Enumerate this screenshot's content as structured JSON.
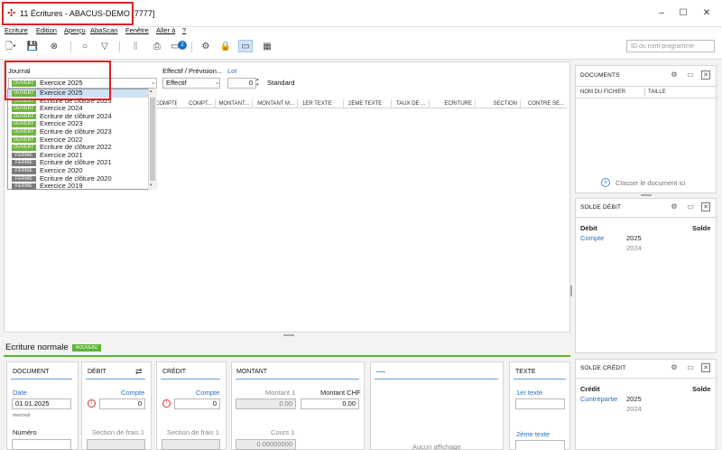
{
  "window": {
    "title": "11 Écritures - ABACUS-DEMO [7777]",
    "buttons": [
      "–",
      "☐",
      "✕"
    ]
  },
  "menu": [
    "Ecriture",
    "Edition",
    "Aperçu",
    "AbaScan",
    "Fenêtre",
    "Aller à",
    "?"
  ],
  "toolbar": {
    "notification_count": "2",
    "search_placeholder": "ID ou nom programme"
  },
  "journal": {
    "label": "Journal",
    "selected_badge": "OUVERT",
    "selected_value": "Exercice 2025",
    "effectif_label": "Effectif / Prévision...",
    "effectif_value": "Effectif",
    "lot_label": "Lot",
    "lot_value": "0",
    "standard_label": "Standard"
  },
  "dropdown_items": [
    {
      "badge": "OUVERT",
      "label": "Exercice 2025"
    },
    {
      "badge": "OUVERT",
      "label": "Ecriture de clôture 2025"
    },
    {
      "badge": "OUVERT",
      "label": "Exercice 2024"
    },
    {
      "badge": "OUVERT",
      "label": "Ecriture de clôture 2024"
    },
    {
      "badge": "OUVERT",
      "label": "Exercice 2023"
    },
    {
      "badge": "OUVERT",
      "label": "Ecriture de clôture 2023"
    },
    {
      "badge": "OUVERT",
      "label": "Exercice 2022"
    },
    {
      "badge": "OUVERT",
      "label": "Ecriture de clôture 2022"
    },
    {
      "badge": "FERMÉ",
      "label": "Exercice 2021"
    },
    {
      "badge": "FERMÉ",
      "label": "Ecriture de clôture 2021"
    },
    {
      "badge": "FERMÉ",
      "label": "Exercice 2020"
    },
    {
      "badge": "FERMÉ",
      "label": "Ecriture de clôture 2020"
    },
    {
      "badge": "FERMÉ",
      "label": "Exercice 2019"
    }
  ],
  "grid_columns": [
    "COMPTE",
    "COMPT...",
    "MONTANT...",
    "MONTANT M...",
    "1ER TEXTE",
    "2ÈME TEXTE",
    "TAUX DE ...",
    "ECRITURE",
    "SECTION",
    "CONTRE SE..."
  ],
  "documents_panel": {
    "title": "DOCUMENTS",
    "col_file": "NOM DU FICHIER",
    "col_size": "TAILLE",
    "classify_label": "Classer le document ici"
  },
  "solde_debit": {
    "title": "SOLDE DÉBIT",
    "col1": "Débit",
    "col2": "Solde",
    "link": "Compte",
    "year1": "2025",
    "year2": "2024"
  },
  "solde_credit": {
    "title": "SOLDE CRÉDIT",
    "col1": "Crédit",
    "col2": "Solde",
    "link": "Contrepartie",
    "year1": "2025",
    "year2": "2024"
  },
  "ecriture": {
    "title": "Ecriture normale",
    "badge": "NOUVEAU"
  },
  "cards": {
    "document": {
      "title": "DOCUMENT",
      "date_label": "Date",
      "date_value": "01.01.2025",
      "weekday": "mercredi",
      "numero_label": "Numéro"
    },
    "debit": {
      "title": "DÉBIT",
      "compte_label": "Compte",
      "compte_value": "0",
      "section_label": "Section de frais 1"
    },
    "credit": {
      "title": "CRÉDIT",
      "compte_label": "Compte",
      "compte_value": "0",
      "section_label": "Section de frais 1"
    },
    "montant": {
      "title": "MONTANT",
      "m1_label": "Montant 1",
      "m1_value": "0.00",
      "chf_label": "Montant CHF",
      "chf_value": "0.00",
      "cours_label": "Cours 1",
      "cours_value": "0.00000000"
    },
    "preview": {
      "title": "—",
      "empty_text": "Aucun affichage"
    },
    "texte": {
      "title": "TEXTE",
      "t1_label": "1er texte",
      "t2_label": "2ème texte"
    }
  }
}
